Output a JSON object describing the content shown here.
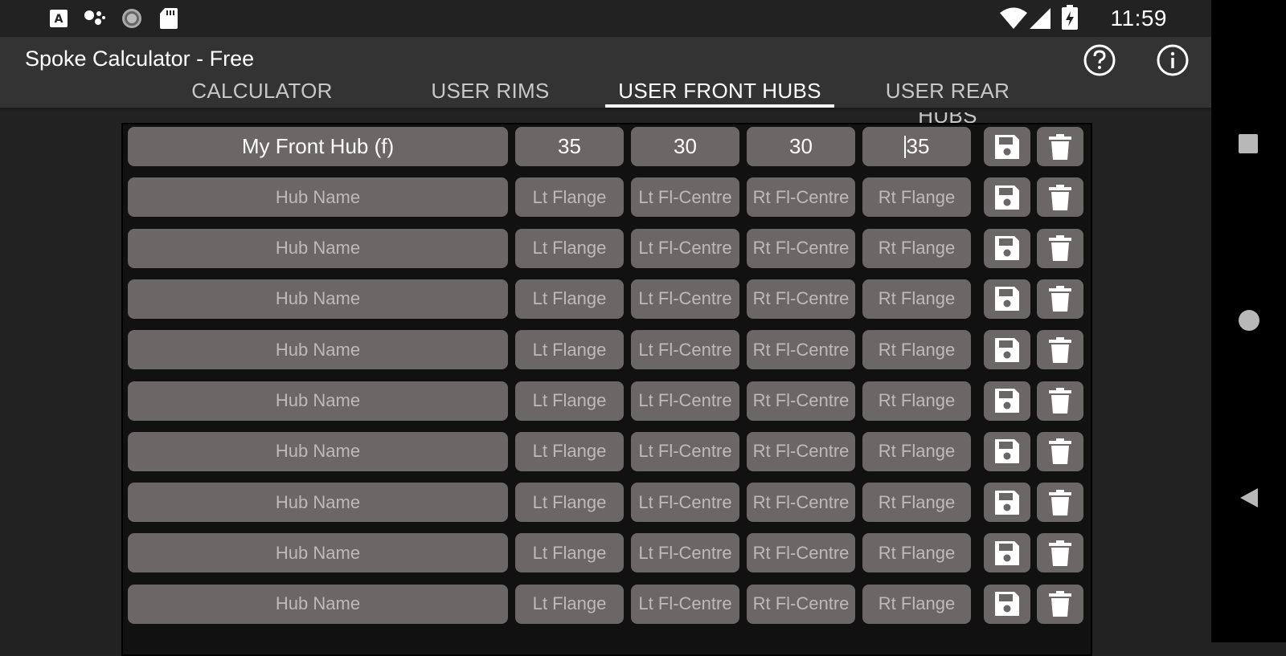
{
  "status_bar": {
    "time": "11:59"
  },
  "app_bar": {
    "title": "Spoke Calculator - Free",
    "help_icon": "help-circle-icon",
    "info_icon": "info-circle-icon"
  },
  "tabs": [
    {
      "label": "CALCULATOR",
      "active": false
    },
    {
      "label": "USER RIMS",
      "active": false
    },
    {
      "label": "USER FRONT HUBS",
      "active": true
    },
    {
      "label": "USER REAR HUBS",
      "active": false
    }
  ],
  "placeholders": {
    "name": "Hub Name",
    "lt_flange": "Lt Flange",
    "lt_fl_centre": "Lt Fl-Centre",
    "rt_fl_centre": "Rt Fl-Centre",
    "rt_flange": "Rt Flange"
  },
  "hubs": [
    {
      "name": "My Front Hub (f)",
      "lt_flange": "35",
      "lt_fl_centre": "30",
      "rt_fl_centre": "30",
      "rt_flange": "35"
    },
    {
      "name": "",
      "lt_flange": "",
      "lt_fl_centre": "",
      "rt_fl_centre": "",
      "rt_flange": ""
    },
    {
      "name": "",
      "lt_flange": "",
      "lt_fl_centre": "",
      "rt_fl_centre": "",
      "rt_flange": ""
    },
    {
      "name": "",
      "lt_flange": "",
      "lt_fl_centre": "",
      "rt_fl_centre": "",
      "rt_flange": ""
    },
    {
      "name": "",
      "lt_flange": "",
      "lt_fl_centre": "",
      "rt_fl_centre": "",
      "rt_flange": ""
    },
    {
      "name": "",
      "lt_flange": "",
      "lt_fl_centre": "",
      "rt_fl_centre": "",
      "rt_flange": ""
    },
    {
      "name": "",
      "lt_flange": "",
      "lt_fl_centre": "",
      "rt_fl_centre": "",
      "rt_flange": ""
    },
    {
      "name": "",
      "lt_flange": "",
      "lt_fl_centre": "",
      "rt_fl_centre": "",
      "rt_flange": ""
    },
    {
      "name": "",
      "lt_flange": "",
      "lt_fl_centre": "",
      "rt_fl_centre": "",
      "rt_flange": ""
    },
    {
      "name": "",
      "lt_flange": "",
      "lt_fl_centre": "",
      "rt_fl_centre": "",
      "rt_flange": ""
    }
  ],
  "row_icons": {
    "save": "save-icon",
    "delete": "trash-icon"
  },
  "colors": {
    "cell": "#6b6766",
    "app_bar": "#333333",
    "background": "#222222",
    "tab_indicator": "#ffffff"
  }
}
